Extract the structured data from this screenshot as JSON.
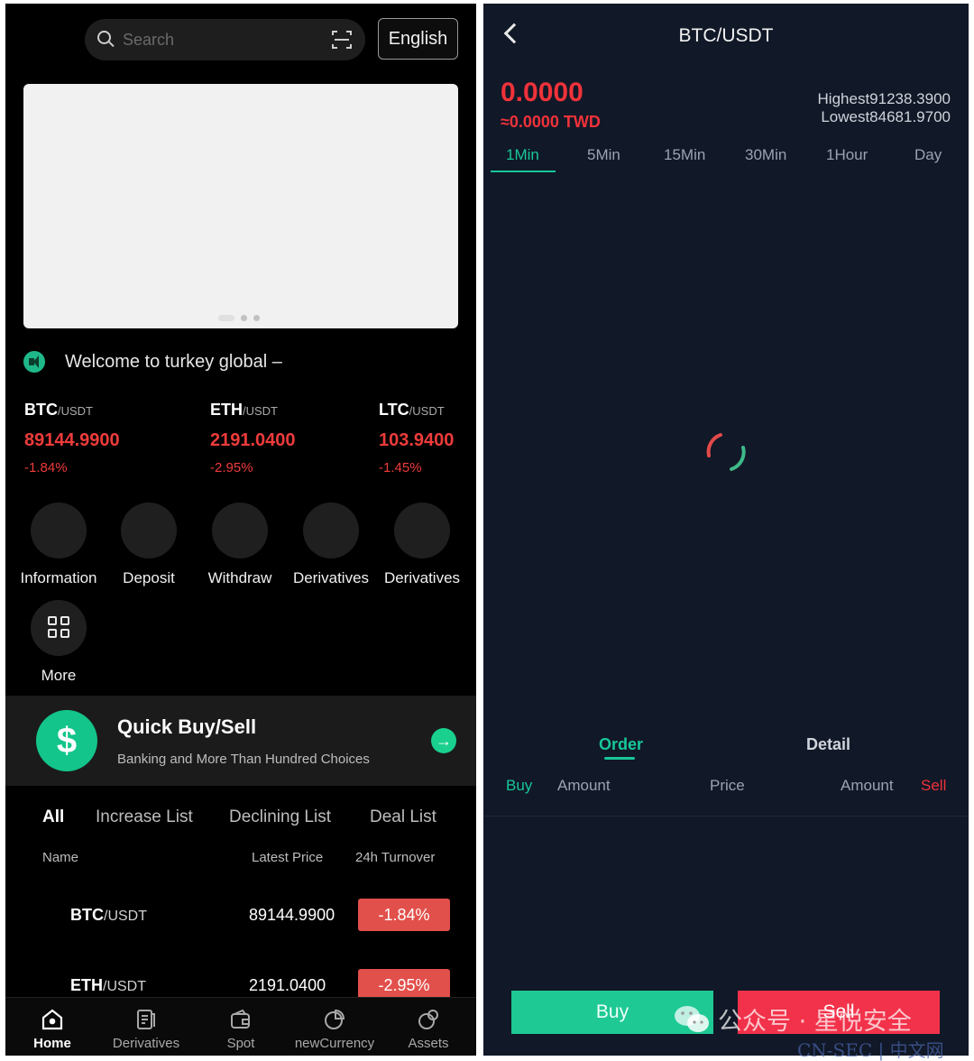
{
  "home": {
    "search_placeholder": "Search",
    "language_button": "English",
    "notice": "Welcome to turkey global –",
    "tickers": [
      {
        "base": "BTC",
        "quote": "/USDT",
        "price": "89144.9900",
        "change": "-1.84%"
      },
      {
        "base": "ETH",
        "quote": "/USDT",
        "price": "2191.0400",
        "change": "-2.95%"
      },
      {
        "base": "LTC",
        "quote": "/USDT",
        "price": "103.9400",
        "change": "-1.45%"
      }
    ],
    "quick_items": [
      "Information",
      "Deposit",
      "Withdraw",
      "Derivatives",
      "Derivatives",
      "More"
    ],
    "quick_buy": {
      "symbol": "$",
      "title": "Quick Buy/Sell",
      "subtitle": "Banking and More Than Hundred Choices",
      "arrow": "→"
    },
    "market_tabs": [
      "All",
      "Increase List",
      "Declining List",
      "Deal List"
    ],
    "market_headers": {
      "name": "Name",
      "latest_price": "Latest Price",
      "turnover": "24h Turnover"
    },
    "market_rows": [
      {
        "base": "BTC",
        "quote": "/USDT",
        "price": "89144.9900",
        "change": "-1.84%"
      },
      {
        "base": "ETH",
        "quote": "/USDT",
        "price": "2191.0400",
        "change": "-2.95%"
      }
    ],
    "tabbar": [
      "Home",
      "Derivatives",
      "Spot",
      "newCurrency",
      "Assets"
    ]
  },
  "trade": {
    "title": "BTC/USDT",
    "price": "0.0000",
    "price_twd": "≈0.0000 TWD",
    "highest": "Highest91238.3900",
    "lowest": "Lowest84681.9700",
    "periods": [
      "1Min",
      "5Min",
      "15Min",
      "30Min",
      "1Hour",
      "Day"
    ],
    "order_tabs": [
      "Order",
      "Detail"
    ],
    "order_headers": {
      "buy": "Buy",
      "amount_left": "Amount",
      "price": "Price",
      "amount_right": "Amount",
      "sell": "Sell"
    },
    "buy_button": "Buy",
    "sell_button": "Sell"
  },
  "watermark": {
    "main": "公众号 · 星悦安全",
    "sub": "CN-SEC | 中文网"
  },
  "colors": {
    "down_red": "#ee3b3b",
    "accent_green": "#18c79a",
    "buy_green": "#1ec994",
    "sell_red": "#f2324a",
    "dark_bg": "#111827"
  }
}
